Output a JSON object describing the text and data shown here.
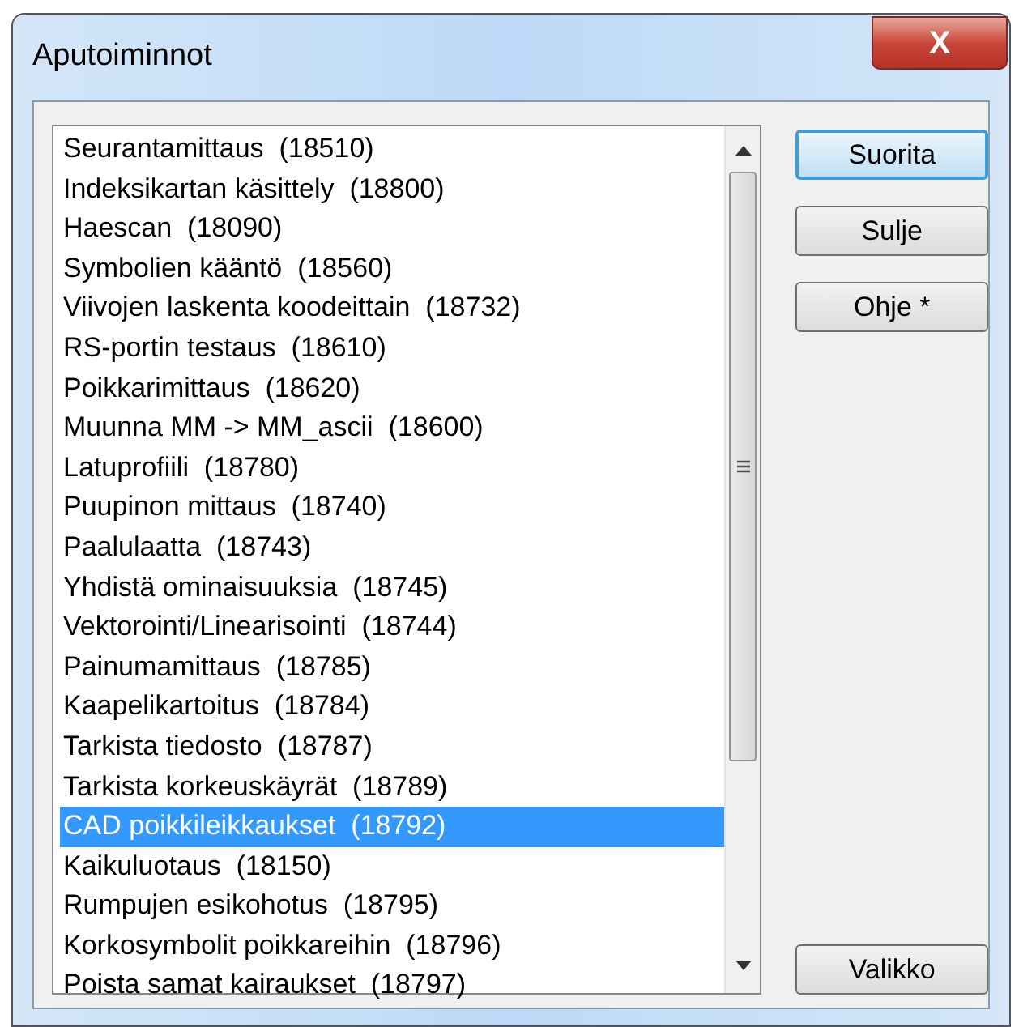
{
  "window": {
    "title": "Aputoiminnot",
    "close": "X"
  },
  "list": {
    "items": [
      {
        "label": "Seurantamittaus  (18510)",
        "selected": false
      },
      {
        "label": "Indeksikartan käsittely  (18800)",
        "selected": false
      },
      {
        "label": "Haescan  (18090)",
        "selected": false
      },
      {
        "label": "Symbolien kääntö  (18560)",
        "selected": false
      },
      {
        "label": "Viivojen laskenta koodeittain  (18732)",
        "selected": false
      },
      {
        "label": "RS-portin testaus  (18610)",
        "selected": false
      },
      {
        "label": "Poikkarimittaus  (18620)",
        "selected": false
      },
      {
        "label": "Muunna MM -> MM_ascii  (18600)",
        "selected": false
      },
      {
        "label": "Latuprofiili  (18780)",
        "selected": false
      },
      {
        "label": "Puupinon mittaus  (18740)",
        "selected": false
      },
      {
        "label": "Paalulaatta  (18743)",
        "selected": false
      },
      {
        "label": "Yhdistä ominaisuuksia  (18745)",
        "selected": false
      },
      {
        "label": "Vektorointi/Linearisointi  (18744)",
        "selected": false
      },
      {
        "label": "Painumamittaus  (18785)",
        "selected": false
      },
      {
        "label": "Kaapelikartoitus  (18784)",
        "selected": false
      },
      {
        "label": "Tarkista tiedosto  (18787)",
        "selected": false
      },
      {
        "label": "Tarkista korkeuskäyrät  (18789)",
        "selected": false
      },
      {
        "label": "CAD poikkileikkaukset  (18792)",
        "selected": true
      },
      {
        "label": "Kaikuluotaus  (18150)",
        "selected": false
      },
      {
        "label": "Rumpujen esikohotus  (18795)",
        "selected": false
      },
      {
        "label": "Korkosymbolit poikkareihin  (18796)",
        "selected": false
      },
      {
        "label": "Poista samat kairaukset  (18797)",
        "selected": false
      }
    ]
  },
  "buttons": [
    {
      "label": "Suorita",
      "default": true
    },
    {
      "label": "Sulje",
      "default": false
    },
    {
      "label": "Ohje *",
      "default": false
    }
  ],
  "bottom_button": {
    "label": "Valikko"
  }
}
